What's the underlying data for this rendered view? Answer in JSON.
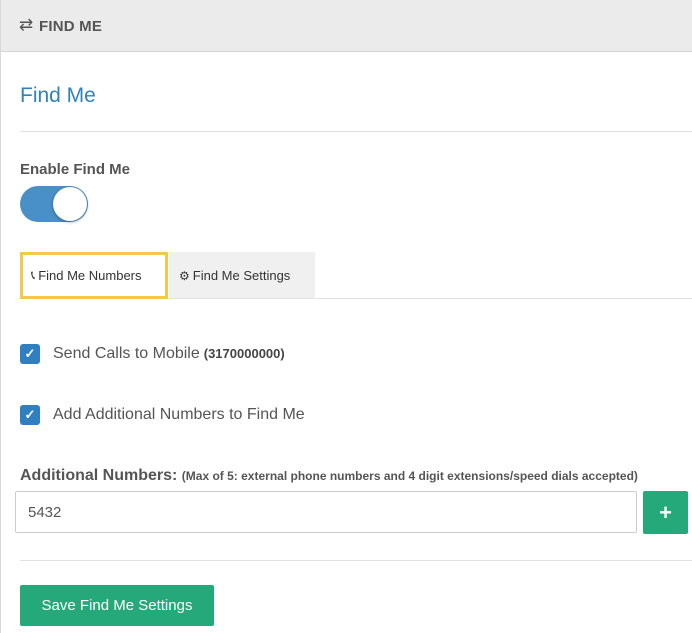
{
  "header": {
    "icon": "swap-arrows-icon",
    "title": "FIND ME"
  },
  "page": {
    "title": "Find Me"
  },
  "enable": {
    "label": "Enable Find Me",
    "on": true
  },
  "tabs": [
    {
      "label": "Find Me Numbers",
      "icon": "phone-icon",
      "active": true
    },
    {
      "label": "Find Me Settings",
      "icon": "gears-icon",
      "active": false
    }
  ],
  "options": [
    {
      "label": "Send Calls to Mobile",
      "extra": "(3170000000)",
      "checked": true
    },
    {
      "label": "Add Additional Numbers to Find Me",
      "checked": true
    }
  ],
  "additional": {
    "label": "Additional Numbers:",
    "note": "(Max of 5: external phone numbers and 4 digit extensions/speed dials accepted)",
    "value": "5432"
  },
  "add_button": {
    "icon": "plus-icon",
    "glyph": "+"
  },
  "save_button": {
    "label": "Save Find Me Settings"
  },
  "colors": {
    "accent": "#2f82be",
    "success": "#25a87a",
    "highlight": "#f2c94c"
  }
}
